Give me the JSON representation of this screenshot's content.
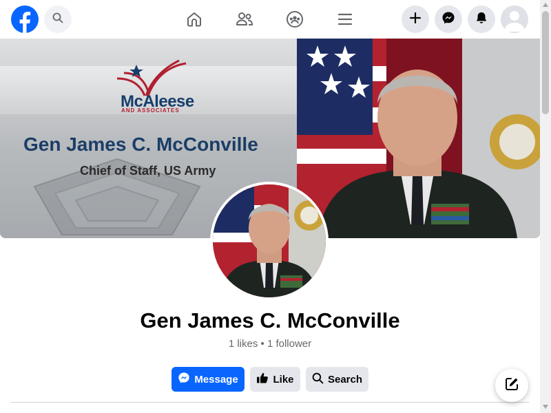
{
  "topbar": {
    "logo": "facebook-logo-icon",
    "search": "search-icon",
    "nav": [
      {
        "icon": "home-icon"
      },
      {
        "icon": "friends-icon"
      },
      {
        "icon": "groups-icon"
      },
      {
        "icon": "menu-icon"
      }
    ],
    "actions": [
      {
        "icon": "plus-icon"
      },
      {
        "icon": "messenger-icon"
      },
      {
        "icon": "bell-icon"
      }
    ],
    "account": "avatar-icon"
  },
  "cover": {
    "brand_name": "McAleese",
    "brand_sub": "AND ASSOCIATES",
    "title": "Gen James C. McConville",
    "subtitle": "Chief of Staff, US Army"
  },
  "profile": {
    "name": "Gen James C. McConville",
    "stats": "1 likes • 1 follower"
  },
  "buttons": {
    "message": "Message",
    "like": "Like",
    "search": "Search"
  },
  "colors": {
    "brand_blue": "#0866ff",
    "grey_button": "#e4e6eb",
    "text": "#050505",
    "muted": "#65676b"
  }
}
